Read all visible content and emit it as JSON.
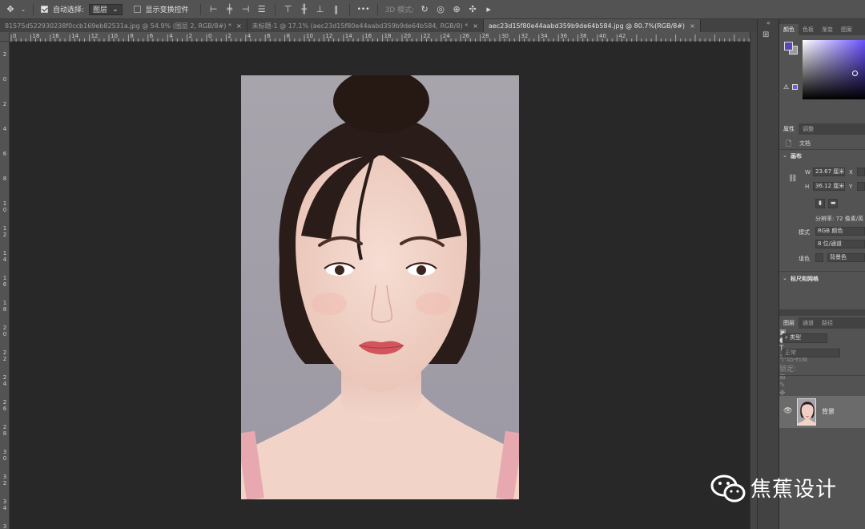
{
  "options_bar": {
    "auto_select_label": "自动选择:",
    "auto_select_value": "图层",
    "show_transform_label": "显示变换控件",
    "mode_3d_label": "3D 模式:",
    "more_label": "•••"
  },
  "tabs": [
    {
      "label": "81575d522930238f0ccb169eb82531a.jpg @ 54.9% (图层 2, RGB/8#) *",
      "close": "×"
    },
    {
      "label": "未标题-1 @ 17.1% (aec23d15f80e44aabd359b9de64b584, RGB/8) *",
      "close": "×"
    },
    {
      "label": "aec23d15f80e44aabd359b9de64b584.jpg @ 80.7%(RGB/8#)",
      "close": "×"
    }
  ],
  "ruler_top_labels": [
    "0",
    "18",
    "16",
    "14",
    "12",
    "10",
    "8",
    "6",
    "4",
    "2",
    "0",
    "2",
    "4",
    "6",
    "8",
    "10",
    "12",
    "14",
    "16",
    "18",
    "20",
    "22",
    "24",
    "26",
    "28",
    "30",
    "32",
    "34",
    "36",
    "38",
    "40",
    "42"
  ],
  "ruler_left_labels": [
    "2",
    "0",
    "2",
    "4",
    "6",
    "8",
    "1 0",
    "1 2",
    "1 4",
    "1 6",
    "1 8",
    "2 0",
    "2 2",
    "2 4",
    "2 6",
    "2 8",
    "3 0",
    "3 2",
    "3 4",
    "3 6"
  ],
  "color_panel": {
    "tabs": [
      "颜色",
      "色板",
      "渐变",
      "图案"
    ],
    "fg_color": "#5648b8",
    "bg_color": "#9a9a9a"
  },
  "properties_panel": {
    "tabs": [
      "属性",
      "调整"
    ],
    "doc_label": "文档",
    "canvas_title": "画布",
    "w_label": "W",
    "w_value": "23.67 厘米",
    "x_label": "X",
    "h_label": "H",
    "h_value": "36.12 厘米",
    "y_label": "Y",
    "resolution": "分辨率: 72 像素/英",
    "mode_label": "模式",
    "mode_value": "RGB 颜色",
    "depth_value": "8 位/通道",
    "fill_label": "填色",
    "fill_value": "背景色",
    "rulers_title": "标尺和网格"
  },
  "layers_panel": {
    "tabs": [
      "图层",
      "通道",
      "路径"
    ],
    "search_placeholder": "类型",
    "blend_mode": "正常",
    "opacity_label": "不透明度",
    "lock_label": "锁定:",
    "fill_label": "填充",
    "layer_name": "背景"
  },
  "watermark": {
    "text": "焦蕉设计"
  }
}
